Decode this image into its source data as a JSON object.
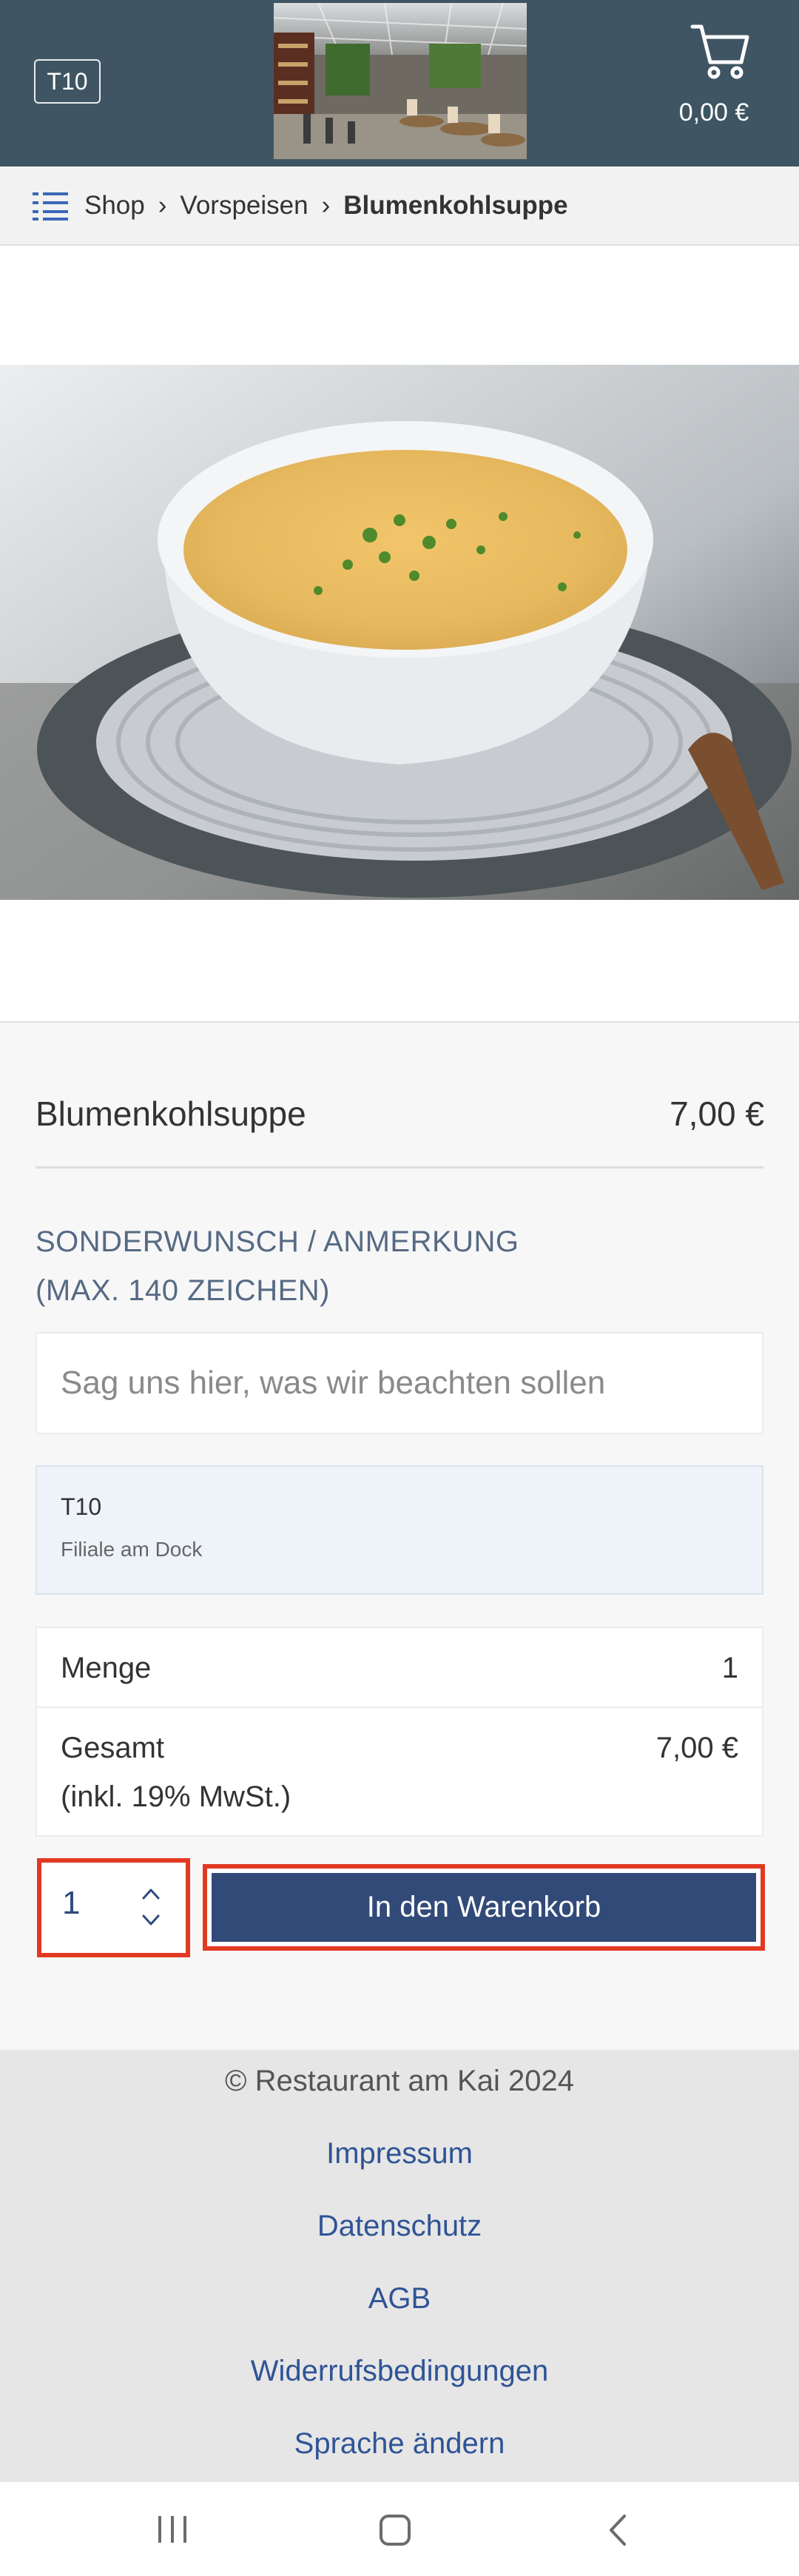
{
  "header": {
    "table_label": "T10",
    "cart_total": "0,00 €"
  },
  "breadcrumb": {
    "items": [
      "Shop",
      "Vorspeisen"
    ],
    "separator": "›",
    "current": "Blumenkohlsuppe"
  },
  "product": {
    "name": "Blumenkohlsuppe",
    "price": "7,00 €",
    "note_label_line1": "SONDERWUNSCH / ANMERKUNG",
    "note_label_line2": "(MAX. 140 ZEICHEN)",
    "note_placeholder": "Sag uns hier, was wir beachten sollen",
    "note_value": ""
  },
  "branch": {
    "table": "T10",
    "name": "Filiale am Dock"
  },
  "summary": {
    "quantity_label": "Menge",
    "quantity_value": "1",
    "total_label": "Gesamt",
    "total_tax_note": "(inkl. 19% MwSt.)",
    "total_value": "7,00 €"
  },
  "cart_action": {
    "quantity": "1",
    "add_label": "In den Warenkorb"
  },
  "footer": {
    "copyright": "© Restaurant am Kai 2024",
    "links": [
      "Impressum",
      "Datenschutz",
      "AGB",
      "Widerrufsbedingungen",
      "Sprache ändern"
    ]
  },
  "icons": {
    "menu": "list-menu-icon",
    "cart": "shopping-cart-icon",
    "qty_up": "chevron-up-icon",
    "qty_down": "chevron-down-icon"
  },
  "colors": {
    "header_bg": "#3f5563",
    "primary_button": "#324a78",
    "link": "#2f5496",
    "highlight": "#e23a22",
    "label_accent": "#566a84"
  }
}
